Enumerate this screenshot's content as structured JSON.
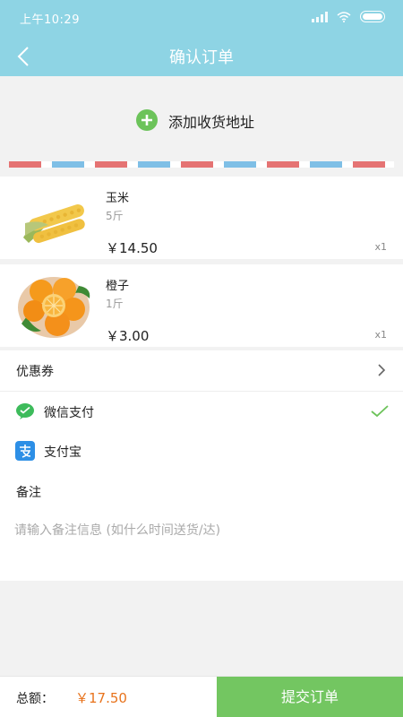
{
  "status_bar": {
    "time": "上午10:29"
  },
  "header": {
    "title": "确认订单",
    "back_icon": "chevron-left-icon"
  },
  "address": {
    "label": "添加收货地址",
    "icon": "plus-circle-icon",
    "icon_color": "#6cc35a"
  },
  "products": [
    {
      "name": "玉米",
      "spec": "5斤",
      "price": "￥14.50",
      "qty": "x1",
      "image": "corn-image"
    },
    {
      "name": "橙子",
      "spec": "1斤",
      "price": "￥3.00",
      "qty": "x1",
      "image": "orange-image"
    }
  ],
  "coupon": {
    "label": "优惠券"
  },
  "payment": {
    "wechat": {
      "label": "微信支付",
      "icon": "wechat-pay-icon",
      "selected": true
    },
    "alipay": {
      "label": "支付宝",
      "icon": "alipay-icon",
      "selected": false
    }
  },
  "note": {
    "label": "备注",
    "placeholder": "请输入备注信息 (如什么时间送货/达)",
    "value": ""
  },
  "footer": {
    "total_label": "总额：",
    "total_value": "￥17.50",
    "submit_label": "提交订单"
  },
  "colors": {
    "header_bg": "#8ed4e4",
    "accent_green": "#73c661",
    "price_orange": "#e8731c"
  }
}
